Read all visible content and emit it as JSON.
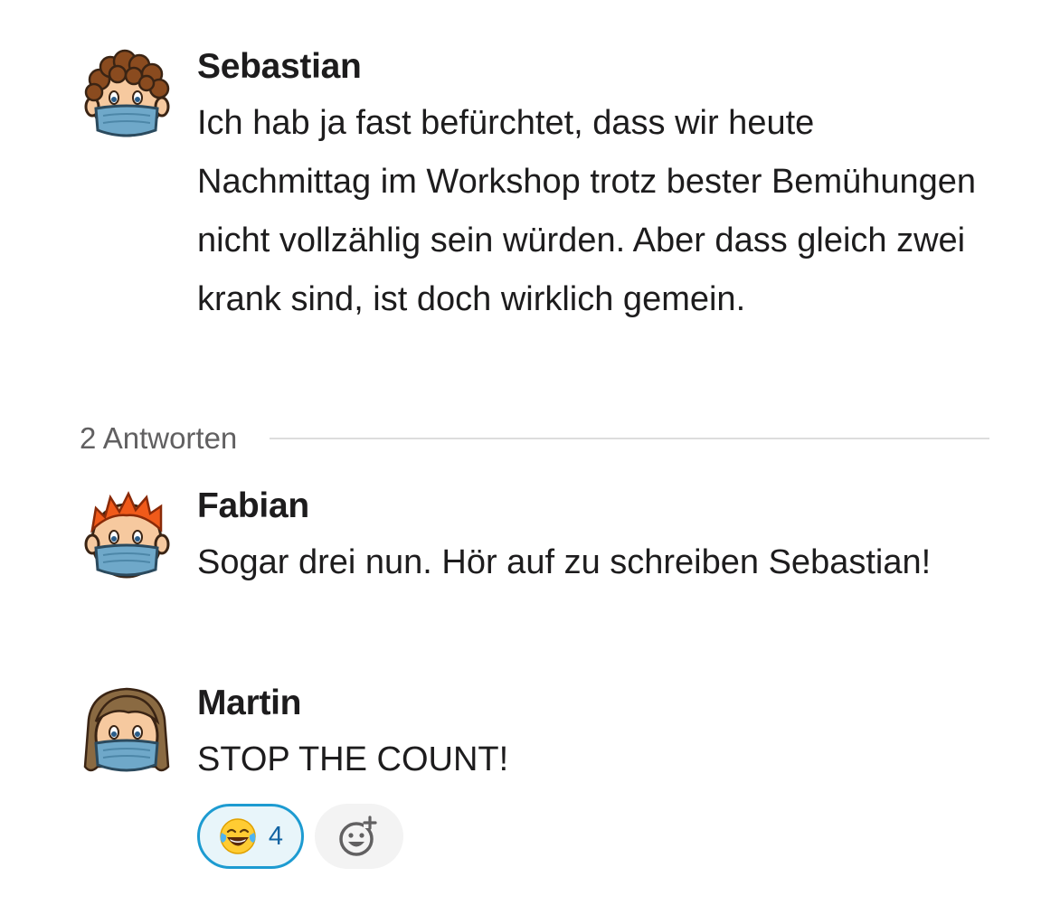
{
  "thread": {
    "root": {
      "author": "Sebastian",
      "avatar_icon": "avatar-curly-brown-hair-mask-icon",
      "text": "Ich hab ja fast befürchtet, dass wir heute Nachmittag im Workshop trotz bester Bemühungen nicht vollzählig sein würden. Aber dass gleich zwei krank sind, ist doch wirklich gemein."
    },
    "replies_label": "2 Antworten",
    "replies": [
      {
        "author": "Fabian",
        "avatar_icon": "avatar-red-hair-mask-icon",
        "text": "Sogar drei nun. Hör auf zu schreiben Sebastian!"
      },
      {
        "author": "Martin",
        "avatar_icon": "avatar-long-brown-hair-mask-icon",
        "text": "STOP THE COUNT!",
        "reactions": [
          {
            "emoji": "tears-of-joy-emoji",
            "count": "4"
          }
        ],
        "add_reaction_icon": "add-reaction-icon"
      }
    ]
  },
  "colors": {
    "reaction_border": "#1d9bd1",
    "reaction_bg": "#e8f5fa",
    "reaction_count": "#1264a3",
    "divider": "#dddddd",
    "muted_text": "#616061"
  }
}
